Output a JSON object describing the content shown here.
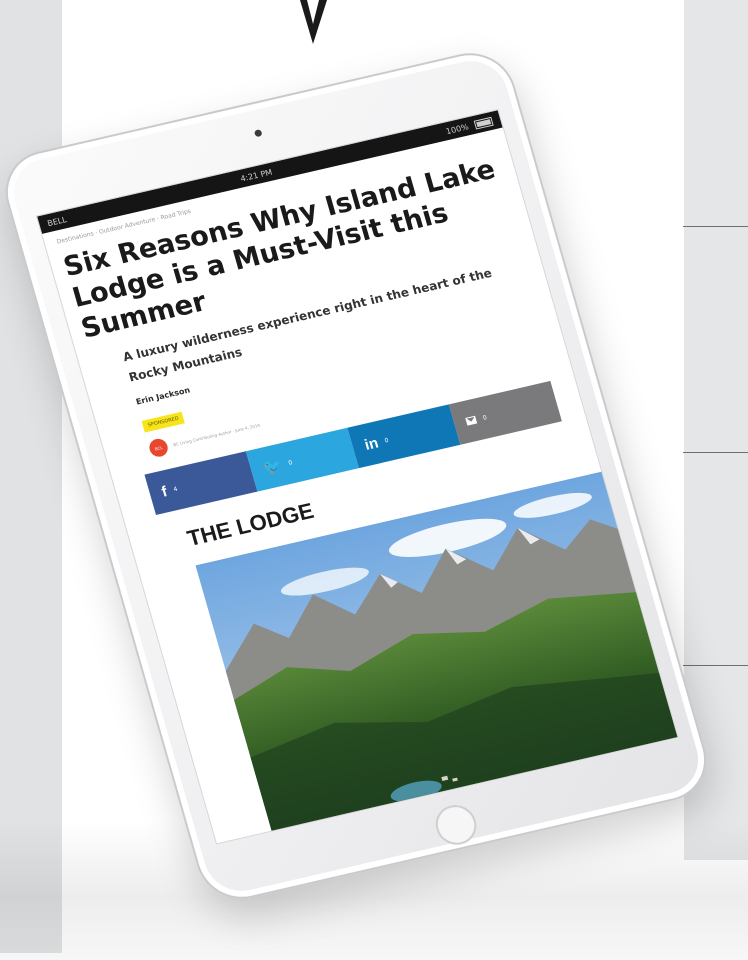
{
  "status_bar": {
    "carrier": "BELL",
    "time": "4:21 PM",
    "battery": "100%"
  },
  "article": {
    "breadcrumb": "Destinations · Outdoor Adventure · Road Trips",
    "title": "Six Reasons Why Island Lake Lodge is a Must-Visit this Summer",
    "subtitle": "A luxury wilderness experience right in the heart of the Rocky Mountains",
    "author": "Erin Jackson",
    "sponsor_badge": "SPONSORED",
    "byline_avatar": "BCL",
    "byline_text": "BC Living Contributing Author · June 4, 2019",
    "section_heading": "THE LODGE"
  },
  "share": {
    "facebook_glyph": "f",
    "facebook_count": "4",
    "twitter_glyph": "🐦",
    "twitter_count": "0",
    "linkedin_glyph": "in",
    "linkedin_count": "0",
    "email_count": "0"
  },
  "icons": {
    "pointer": "down-arrow-icon",
    "email": "envelope-icon"
  },
  "colors": {
    "facebook": "#3b5999",
    "twitter": "#2ca6df",
    "linkedin": "#0f77b6",
    "email": "#7a7a7c",
    "sponsor": "#f7e51b"
  }
}
